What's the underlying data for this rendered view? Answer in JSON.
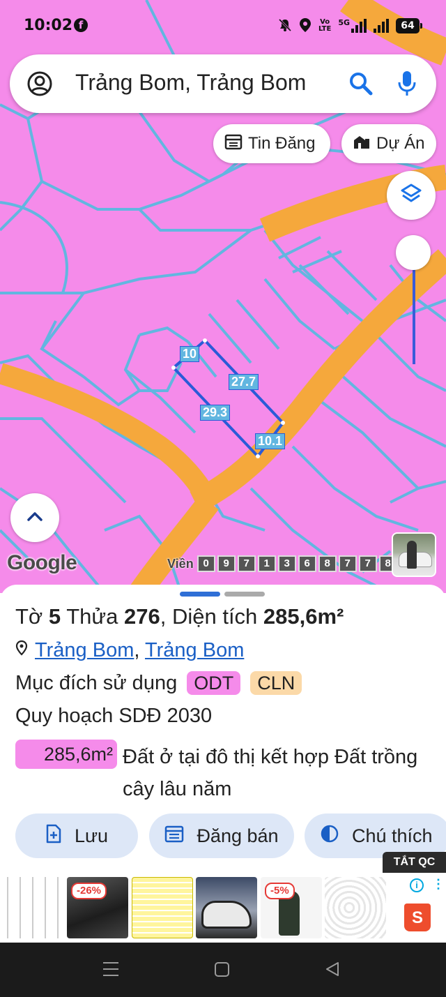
{
  "status_bar": {
    "time": "10:02",
    "notification_app_icon": "facebook-icon",
    "facebook_glyph": "f",
    "network_label": "Vo LTE",
    "volte_line1": "Vo",
    "volte_line2": "LTE",
    "signal_label": "5G",
    "battery_level": "64",
    "icons": [
      "bell-off-icon",
      "location-pin-icon",
      "volte-icon",
      "signal-5g-icon",
      "signal-bars-icon",
      "battery-icon"
    ]
  },
  "search": {
    "query": "Trảng Bom, Trảng Bom",
    "icons": [
      "account-circle-icon",
      "search-icon",
      "microphone-icon"
    ]
  },
  "chips": [
    {
      "label": "Tin Đăng",
      "icon": "listing-calendar-icon"
    },
    {
      "label": "Dự Án",
      "icon": "building-icon"
    }
  ],
  "map": {
    "colors": {
      "residential_land": "#f58bea",
      "road": "#f5a83c",
      "parcel_lines": "#62b6e0",
      "selected_parcel": "#2a5bd7"
    },
    "parcel_edge_labels": [
      "10",
      "27.7",
      "29.3",
      "10.1"
    ],
    "attribution": "Google",
    "parcel_id_prefix": "Viền",
    "parcel_id_digits": [
      "0",
      "9",
      "7",
      "1",
      "3",
      "6",
      "8",
      "7",
      "7",
      "8"
    ],
    "zoom_level_fraction": 0.0
  },
  "sheet": {
    "title_parts": {
      "to_label": "Tờ",
      "to_value": "5",
      "thua_label": "Thửa",
      "thua_value": "276",
      "dien_tich_label": ", Diện tích",
      "dien_tich_value": "285,6m²"
    },
    "location": {
      "district": "Trảng Bom",
      "separator": ",",
      "commune": "Trảng Bom"
    },
    "purpose_label": "Mục đích sử dụng",
    "purpose_tags": [
      {
        "code": "ODT",
        "color": "#f58bea"
      },
      {
        "code": "CLN",
        "color": "#fbd9a8"
      }
    ],
    "plan_label": "Quy hoạch SDĐ 2030",
    "plan_area": "285,6m²",
    "plan_description": "Đất ở tại đô thị kết hợp Đất trồng cây lâu năm",
    "actions": [
      {
        "label": "Lưu",
        "icon": "add-document-icon"
      },
      {
        "label": "Đăng bán",
        "icon": "calendar-icon"
      },
      {
        "label": "Chú thích",
        "icon": "half-circle-icon"
      }
    ]
  },
  "ads": {
    "close_label": "TẮT QC",
    "badges": [
      "-26%",
      "-5%"
    ],
    "info_glyph": "i",
    "more_glyph": "⋮",
    "shopee_glyph": "S"
  },
  "nav_icons": [
    "recent-apps-icon",
    "home-icon",
    "back-icon"
  ]
}
